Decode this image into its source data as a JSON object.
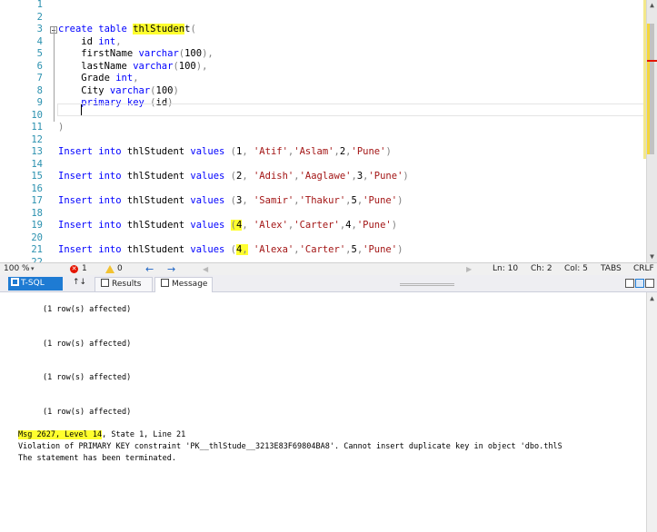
{
  "editor": {
    "lines": [
      {
        "n": "1",
        "tokens": []
      },
      {
        "n": "2",
        "tokens": []
      },
      {
        "n": "3",
        "fold": true,
        "tokens": [
          {
            "t": "create",
            "c": "kw"
          },
          {
            "t": " ",
            "c": "tx"
          },
          {
            "t": "table",
            "c": "kw"
          },
          {
            "t": " ",
            "c": "tx"
          },
          {
            "t": "thlStuden",
            "c": "tx",
            "hl": true
          },
          {
            "t": "t",
            "c": "tx"
          },
          {
            "t": "(",
            "c": "gy"
          }
        ]
      },
      {
        "n": "4",
        "tokens": [
          {
            "t": "    id ",
            "c": "tx"
          },
          {
            "t": "int",
            "c": "ty"
          },
          {
            "t": ",",
            "c": "gy"
          }
        ]
      },
      {
        "n": "5",
        "tokens": [
          {
            "t": "    firstName ",
            "c": "tx"
          },
          {
            "t": "varchar",
            "c": "ty"
          },
          {
            "t": "(",
            "c": "gy"
          },
          {
            "t": "100",
            "c": "tx"
          },
          {
            "t": "),",
            "c": "gy"
          }
        ]
      },
      {
        "n": "6",
        "tokens": [
          {
            "t": "    lastName ",
            "c": "tx"
          },
          {
            "t": "varchar",
            "c": "ty"
          },
          {
            "t": "(",
            "c": "gy"
          },
          {
            "t": "100",
            "c": "tx"
          },
          {
            "t": "),",
            "c": "gy"
          }
        ]
      },
      {
        "n": "7",
        "tokens": [
          {
            "t": "    Grade ",
            "c": "tx"
          },
          {
            "t": "int",
            "c": "ty"
          },
          {
            "t": ",",
            "c": "gy"
          }
        ]
      },
      {
        "n": "8",
        "tokens": [
          {
            "t": "    City ",
            "c": "tx"
          },
          {
            "t": "varchar",
            "c": "ty"
          },
          {
            "t": "(",
            "c": "gy"
          },
          {
            "t": "100",
            "c": "tx"
          },
          {
            "t": ")",
            "c": "gy"
          }
        ]
      },
      {
        "n": "9",
        "tokens": [
          {
            "t": "    ",
            "c": "tx"
          },
          {
            "t": "primary key",
            "c": "kw"
          },
          {
            "t": " ",
            "c": "tx"
          },
          {
            "t": "(",
            "c": "gy"
          },
          {
            "t": "id",
            "c": "tx"
          },
          {
            "t": ")",
            "c": "gy"
          }
        ]
      },
      {
        "n": "10",
        "tokens": []
      },
      {
        "n": "11",
        "tokens": [
          {
            "t": ")",
            "c": "gy"
          }
        ]
      },
      {
        "n": "12",
        "tokens": []
      },
      {
        "n": "13",
        "tokens": [
          {
            "t": "Insert into",
            "c": "kw"
          },
          {
            "t": " thlStudent ",
            "c": "tx"
          },
          {
            "t": "values",
            "c": "kw"
          },
          {
            "t": " ",
            "c": "tx"
          },
          {
            "t": "(",
            "c": "gy"
          },
          {
            "t": "1",
            "c": "tx"
          },
          {
            "t": ",",
            "c": "gy"
          },
          {
            "t": " ",
            "c": "tx"
          },
          {
            "t": "'Atif'",
            "c": "st"
          },
          {
            "t": ",",
            "c": "gy"
          },
          {
            "t": "'Aslam'",
            "c": "st"
          },
          {
            "t": ",",
            "c": "gy"
          },
          {
            "t": "2",
            "c": "tx"
          },
          {
            "t": ",",
            "c": "gy"
          },
          {
            "t": "'Pune'",
            "c": "st"
          },
          {
            "t": ")",
            "c": "gy"
          }
        ]
      },
      {
        "n": "14",
        "tokens": []
      },
      {
        "n": "15",
        "tokens": [
          {
            "t": "Insert into",
            "c": "kw"
          },
          {
            "t": " thlStudent ",
            "c": "tx"
          },
          {
            "t": "values",
            "c": "kw"
          },
          {
            "t": " ",
            "c": "tx"
          },
          {
            "t": "(",
            "c": "gy"
          },
          {
            "t": "2",
            "c": "tx"
          },
          {
            "t": ",",
            "c": "gy"
          },
          {
            "t": " ",
            "c": "tx"
          },
          {
            "t": "'Adish'",
            "c": "st"
          },
          {
            "t": ",",
            "c": "gy"
          },
          {
            "t": "'Aaglawe'",
            "c": "st"
          },
          {
            "t": ",",
            "c": "gy"
          },
          {
            "t": "3",
            "c": "tx"
          },
          {
            "t": ",",
            "c": "gy"
          },
          {
            "t": "'Pune'",
            "c": "st"
          },
          {
            "t": ")",
            "c": "gy"
          }
        ]
      },
      {
        "n": "16",
        "tokens": []
      },
      {
        "n": "17",
        "tokens": [
          {
            "t": "Insert into",
            "c": "kw"
          },
          {
            "t": " thlStudent ",
            "c": "tx"
          },
          {
            "t": "values",
            "c": "kw"
          },
          {
            "t": " ",
            "c": "tx"
          },
          {
            "t": "(",
            "c": "gy"
          },
          {
            "t": "3",
            "c": "tx"
          },
          {
            "t": ",",
            "c": "gy"
          },
          {
            "t": " ",
            "c": "tx"
          },
          {
            "t": "'Samir'",
            "c": "st"
          },
          {
            "t": ",",
            "c": "gy"
          },
          {
            "t": "'Thakur'",
            "c": "st"
          },
          {
            "t": ",",
            "c": "gy"
          },
          {
            "t": "5",
            "c": "tx"
          },
          {
            "t": ",",
            "c": "gy"
          },
          {
            "t": "'Pune'",
            "c": "st"
          },
          {
            "t": ")",
            "c": "gy"
          }
        ]
      },
      {
        "n": "18",
        "tokens": []
      },
      {
        "n": "19",
        "tokens": [
          {
            "t": "Insert into",
            "c": "kw"
          },
          {
            "t": " thlStudent ",
            "c": "tx"
          },
          {
            "t": "values",
            "c": "kw"
          },
          {
            "t": " ",
            "c": "tx"
          },
          {
            "t": "(",
            "c": "gy",
            "hl": true
          },
          {
            "t": "4",
            "c": "tx",
            "hl": true
          },
          {
            "t": ",",
            "c": "gy"
          },
          {
            "t": " ",
            "c": "tx"
          },
          {
            "t": "'Alex'",
            "c": "st"
          },
          {
            "t": ",",
            "c": "gy"
          },
          {
            "t": "'Carter'",
            "c": "st"
          },
          {
            "t": ",",
            "c": "gy"
          },
          {
            "t": "4",
            "c": "tx"
          },
          {
            "t": ",",
            "c": "gy"
          },
          {
            "t": "'Pune'",
            "c": "st"
          },
          {
            "t": ")",
            "c": "gy"
          }
        ]
      },
      {
        "n": "20",
        "tokens": []
      },
      {
        "n": "21",
        "tokens": [
          {
            "t": "Insert into",
            "c": "kw"
          },
          {
            "t": " thlStudent ",
            "c": "tx"
          },
          {
            "t": "values",
            "c": "kw"
          },
          {
            "t": " ",
            "c": "tx"
          },
          {
            "t": "(",
            "c": "gy"
          },
          {
            "t": "4",
            "c": "tx",
            "hl": true
          },
          {
            "t": ",",
            "c": "gy",
            "hl": true
          },
          {
            "t": " ",
            "c": "tx"
          },
          {
            "t": "'Alexa'",
            "c": "st"
          },
          {
            "t": ",",
            "c": "gy"
          },
          {
            "t": "'Carter'",
            "c": "st"
          },
          {
            "t": ",",
            "c": "gy"
          },
          {
            "t": "5",
            "c": "tx"
          },
          {
            "t": ",",
            "c": "gy"
          },
          {
            "t": "'Pune'",
            "c": "st"
          },
          {
            "t": ")",
            "c": "gy"
          }
        ]
      },
      {
        "n": "22",
        "tokens": []
      }
    ]
  },
  "statusbar": {
    "zoom": "100 %",
    "errors": "1",
    "warnings": "0",
    "line": "Ln: 10",
    "col": "Col: 5",
    "ch": "Ch: 2",
    "mode": "TABS",
    "eol": "CRLF"
  },
  "tabs": {
    "tsql": "T-SQL",
    "results": "Results",
    "message": "Message"
  },
  "messages": {
    "affected": [
      "(1 row(s) affected)",
      "(1 row(s) affected)",
      "(1 row(s) affected)",
      "(1 row(s) affected)"
    ],
    "error_head_hl": "Msg 2627, Level 14",
    "error_head_rest": ", State 1, Line 21",
    "error_detail": "Violation of PRIMARY KEY constraint 'PK__thlStude__3213E83F69804BA8'. Cannot insert duplicate key in object 'dbo.thlS",
    "terminated": "The statement has been terminated."
  },
  "colors": {
    "keyword": "#0000ff",
    "string": "#a31515",
    "line_number": "#2b91af",
    "highlight": "#ffff2e",
    "error": "#e51400",
    "accent": "#1e7bd3"
  }
}
